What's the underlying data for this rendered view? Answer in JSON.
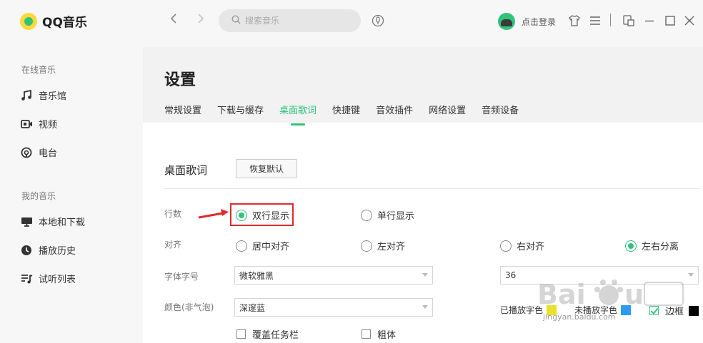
{
  "app": {
    "name": "QQ音乐"
  },
  "sidebar": {
    "groups": [
      {
        "title": "在线音乐",
        "items": [
          {
            "label": "音乐馆",
            "icon": "music-note-icon"
          },
          {
            "label": "视频",
            "icon": "video-icon"
          },
          {
            "label": "电台",
            "icon": "radio-icon"
          }
        ]
      },
      {
        "title": "我的音乐",
        "items": [
          {
            "label": "本地和下载",
            "icon": "monitor-icon"
          },
          {
            "label": "播放历史",
            "icon": "history-icon"
          },
          {
            "label": "试听列表",
            "icon": "playlist-icon"
          }
        ]
      }
    ]
  },
  "topbar": {
    "search_placeholder": "搜索音乐",
    "login_label": "点击登录",
    "icons": [
      "back-icon",
      "forward-icon",
      "search-icon",
      "voice-search-icon",
      "skin-icon",
      "menu-icon",
      "mini-mode-icon",
      "minimize-icon",
      "maximize-icon",
      "close-icon"
    ]
  },
  "page": {
    "title": "设置",
    "tabs": [
      "常规设置",
      "下载与缓存",
      "桌面歌词",
      "快捷键",
      "音效插件",
      "网络设置",
      "音频设备"
    ],
    "active_tab": "桌面歌词"
  },
  "lyrics": {
    "section_title": "桌面歌词",
    "reset_label": "恢复默认",
    "rows_label": "行数",
    "rows_options": [
      {
        "label": "双行显示",
        "checked": true
      },
      {
        "label": "单行显示",
        "checked": false
      }
    ],
    "align_label": "对齐",
    "align_options": [
      {
        "label": "居中对齐",
        "checked": false
      },
      {
        "label": "左对齐",
        "checked": false
      },
      {
        "label": "右对齐",
        "checked": false
      },
      {
        "label": "左右分离",
        "checked": true
      }
    ],
    "font_label": "字体字号",
    "font_value": "微软雅黑",
    "size_value": "36",
    "color_label": "颜色(非气泡)",
    "color_value": "深邃蓝",
    "played_color_label": "已播放字色",
    "unplayed_color_label": "未播放字色",
    "border_label": "边框",
    "border_checked": true,
    "overlay_taskbar_label": "覆盖任务栏",
    "bold_label": "粗体",
    "colors": {
      "played": "#e8e02a",
      "unplayed": "#2d9bf0",
      "border": "#000000",
      "accent": "#31c27c"
    }
  },
  "watermark": {
    "text": "jingyan.baidu.com"
  }
}
